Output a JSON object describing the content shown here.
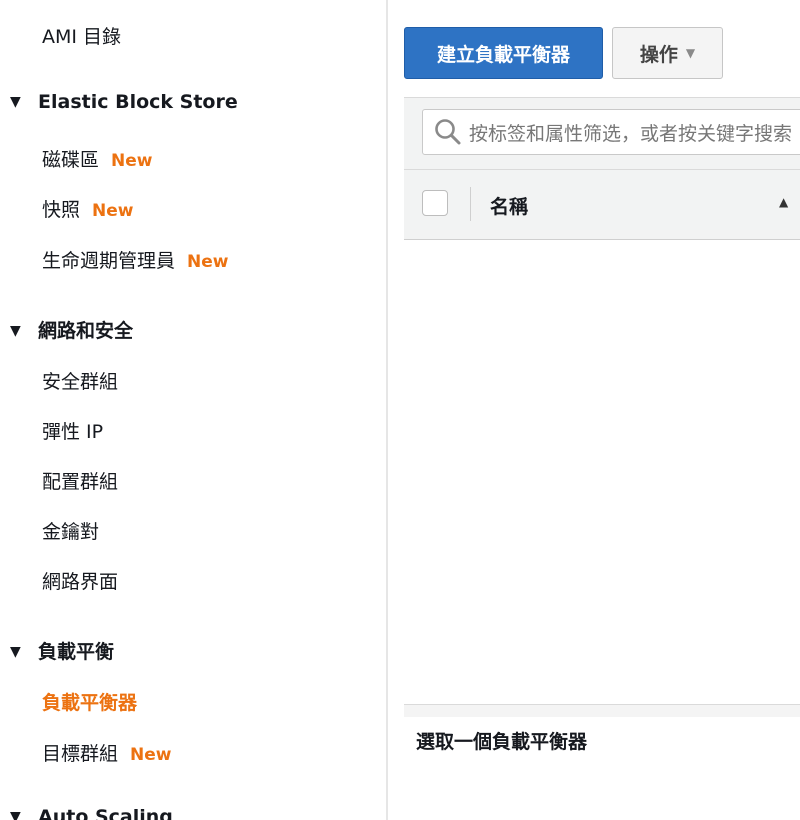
{
  "sidebar": {
    "top_item": "AMI 目錄",
    "sections": [
      {
        "title": "Elastic Block Store",
        "items": [
          {
            "label": "磁碟區",
            "badge": "New"
          },
          {
            "label": "快照",
            "badge": "New"
          },
          {
            "label": "生命週期管理員",
            "badge": "New"
          }
        ]
      },
      {
        "title": "網路和安全",
        "items": [
          {
            "label": "安全群組"
          },
          {
            "label": "彈性 IP"
          },
          {
            "label": "配置群組"
          },
          {
            "label": "金鑰對"
          },
          {
            "label": "網路界面"
          }
        ]
      },
      {
        "title": "負載平衡",
        "items": [
          {
            "label": "負載平衡器",
            "active": true
          },
          {
            "label": "目標群組",
            "badge": "New"
          }
        ]
      },
      {
        "title": "Auto Scaling",
        "items": []
      }
    ]
  },
  "toolbar": {
    "create_label": "建立負載平衡器",
    "actions_label": "操作"
  },
  "search": {
    "placeholder": "按标签和属性筛选，或者按关键字搜索"
  },
  "table": {
    "columns": [
      "名稱"
    ]
  },
  "details": {
    "empty_text": "選取一個負載平衡器"
  },
  "colors": {
    "accent": "#ec7211",
    "primary_button": "#2e73c4"
  },
  "icons": {
    "section_toggle": "triangle-down-icon",
    "search": "search-icon",
    "dropdown": "chevron-down-icon",
    "sort": "sort-ascending-icon"
  }
}
